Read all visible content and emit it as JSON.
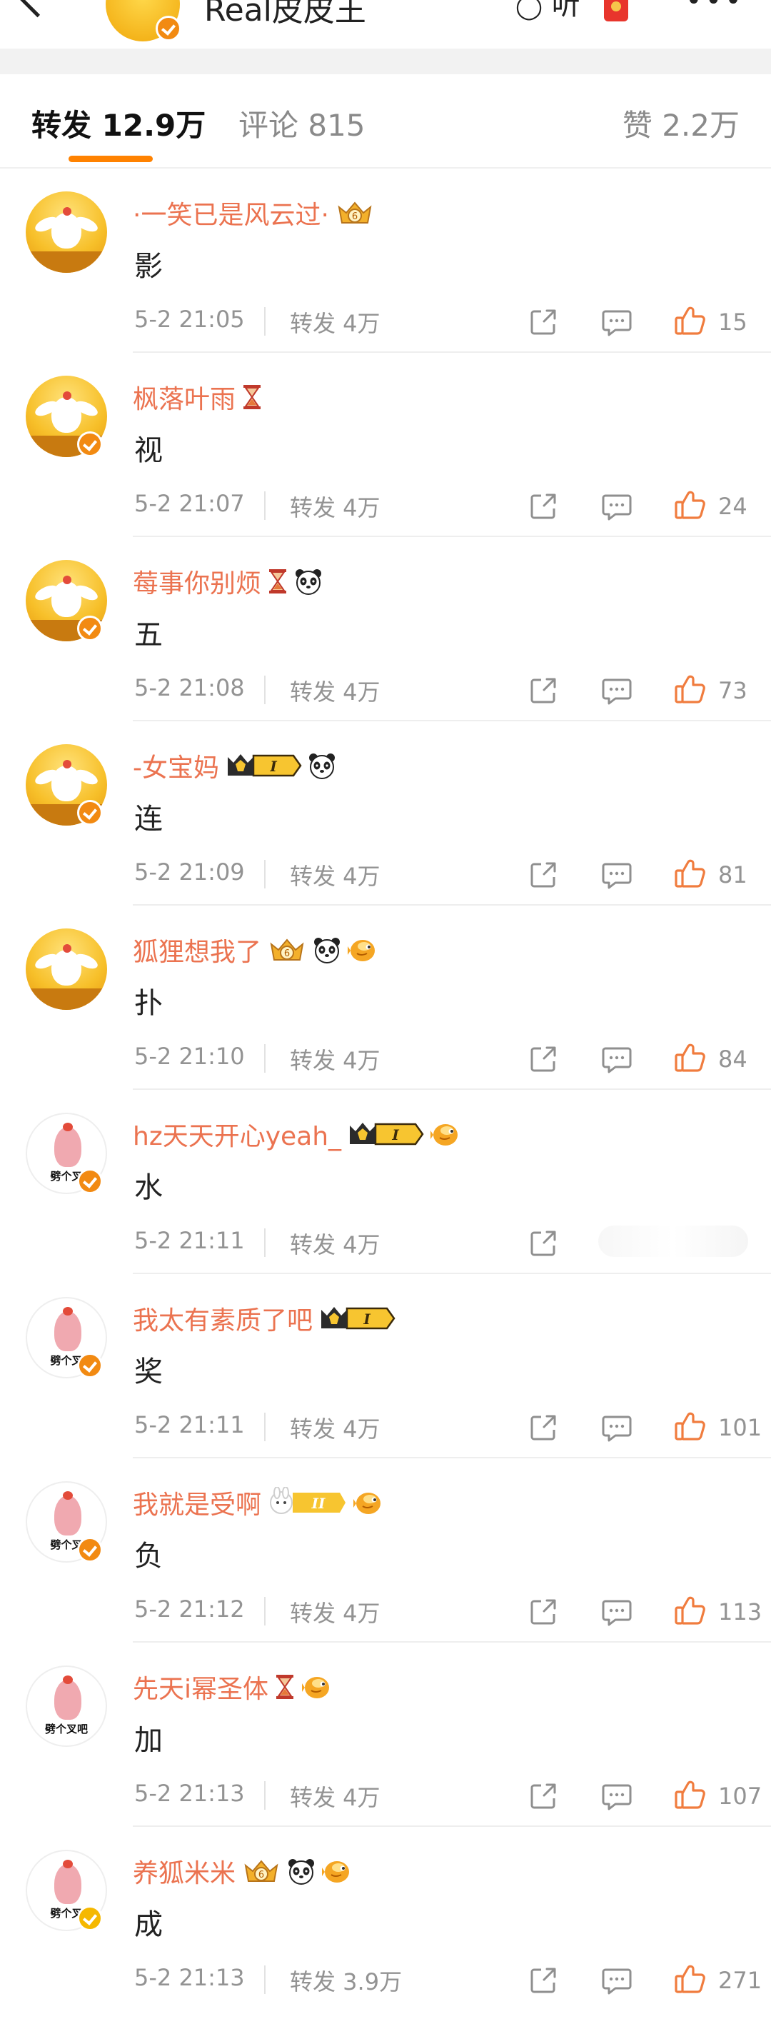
{
  "header": {
    "title": "Real皮皮王",
    "listen_label": "听",
    "back_icon": "back-arrow-icon",
    "redpack_icon": "red-packet-icon",
    "more_icon": "more-dots-icon"
  },
  "tabs": {
    "repost": "转发 12.9万",
    "comment": "评论 815",
    "like": "赞 2.2万"
  },
  "colors": {
    "accent": "#ff8200",
    "username": "#eb7350",
    "meta": "#939393"
  },
  "items": [
    {
      "name": "·一笑已是风云过·",
      "content": "影",
      "time": "5-2 21:05",
      "repost": "转发 4万",
      "likes": "15",
      "avatar": "chick",
      "verified": false,
      "badges": [
        "crown-gold"
      ]
    },
    {
      "name": "枫落叶雨",
      "content": "视",
      "time": "5-2 21:07",
      "repost": "转发 4万",
      "likes": "24",
      "avatar": "chick",
      "verified": true,
      "badges": [
        "hourglass"
      ]
    },
    {
      "name": "莓事你别烦",
      "content": "五",
      "time": "5-2 21:08",
      "repost": "转发 4万",
      "likes": "73",
      "avatar": "chick",
      "verified": true,
      "badges": [
        "hourglass",
        "panda"
      ]
    },
    {
      "name": "-女宝妈",
      "content": "连",
      "time": "5-2 21:09",
      "repost": "转发 4万",
      "likes": "81",
      "avatar": "chick",
      "verified": true,
      "badges": [
        "vip-I",
        "panda"
      ]
    },
    {
      "name": "狐狸想我了",
      "content": "扑",
      "time": "5-2 21:10",
      "repost": "转发 4万",
      "likes": "84",
      "avatar": "chick",
      "verified": false,
      "badges": [
        "crown-gold",
        "panda",
        "fish"
      ]
    },
    {
      "name": "hz天天开心yeah_",
      "content": "水",
      "time": "5-2 21:11",
      "repost": "转发 4万",
      "likes": "",
      "avatar": "pink",
      "verified": true,
      "badges": [
        "vip-I",
        "fish"
      ]
    },
    {
      "name": "我太有素质了吧",
      "content": "奖",
      "time": "5-2 21:11",
      "repost": "转发 4万",
      "likes": "101",
      "avatar": "pink",
      "verified": true,
      "badges": [
        "vip-I"
      ]
    },
    {
      "name": "我就是受啊",
      "content": "负",
      "time": "5-2 21:12",
      "repost": "转发 4万",
      "likes": "113",
      "avatar": "pink",
      "verified": true,
      "badges": [
        "vip-II",
        "fish"
      ]
    },
    {
      "name": "先天i幂圣体",
      "content": "加",
      "time": "5-2 21:13",
      "repost": "转发 4万",
      "likes": "107",
      "avatar": "pink-plain",
      "verified": false,
      "badges": [
        "hourglass",
        "fish"
      ]
    },
    {
      "name": "养狐米米",
      "content": "成",
      "time": "5-2 21:13",
      "repost": "转发 3.9万",
      "likes": "271",
      "avatar": "pink",
      "verified": true,
      "verified_color": "yellow",
      "badges": [
        "crown-gold",
        "panda",
        "fish"
      ]
    }
  ],
  "labels": {
    "vip_I": "I",
    "vip_II": "II",
    "avatar_caption": "劈个叉",
    "avatar_caption_long": "劈个叉吧",
    "crown_level": "6"
  }
}
